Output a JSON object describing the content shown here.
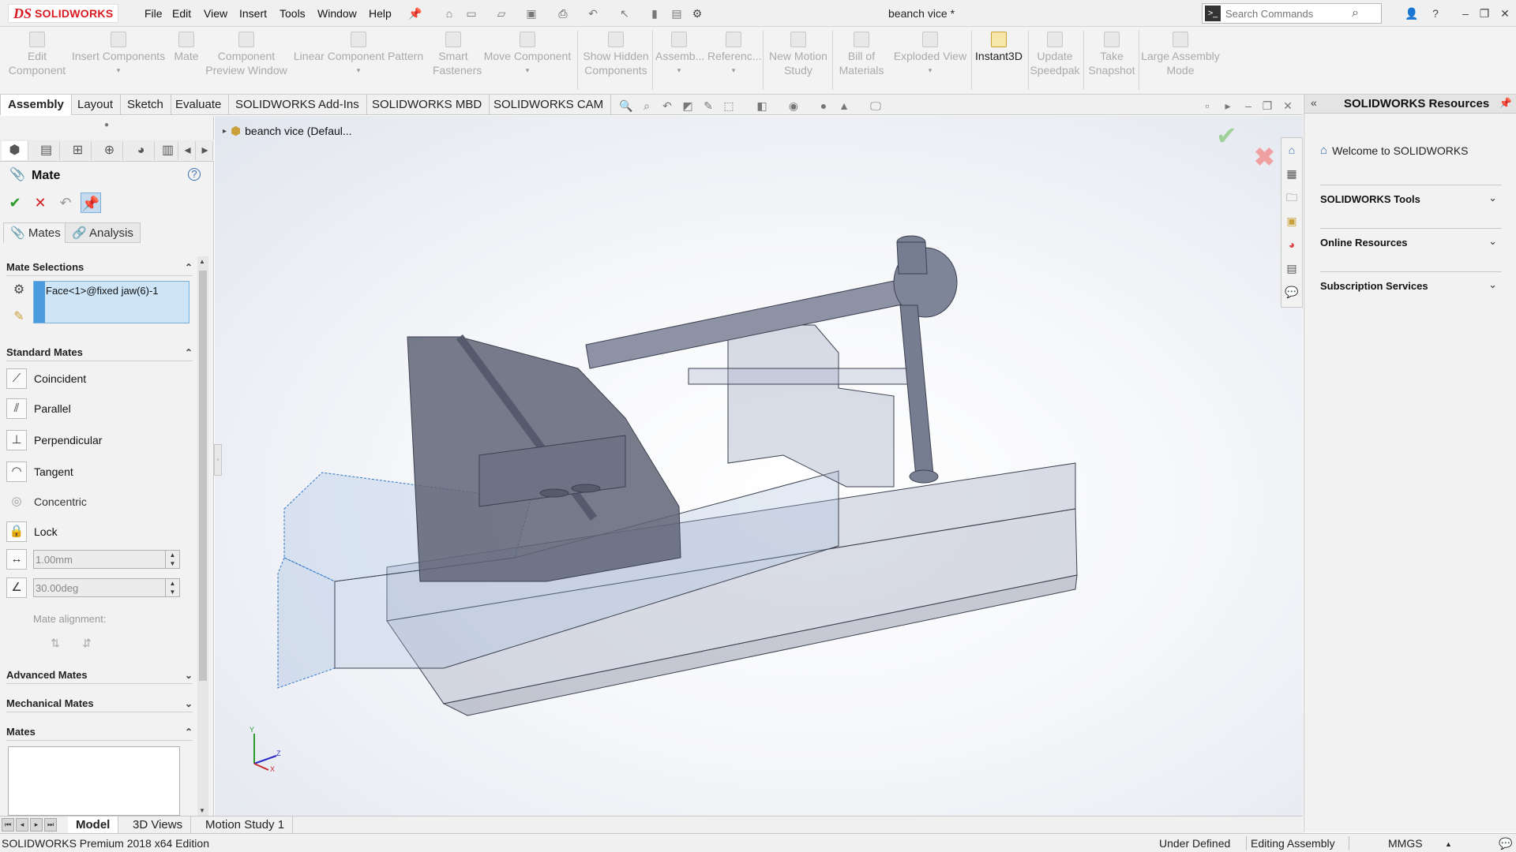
{
  "app": {
    "logo_ds": "DS",
    "logo_text": "SOLIDWORKS",
    "document_title": "beanch vice *"
  },
  "menu": [
    "File",
    "Edit",
    "View",
    "Insert",
    "Tools",
    "Window",
    "Help"
  ],
  "search": {
    "placeholder": "Search Commands"
  },
  "command_manager": [
    {
      "label": "Edit\nComponent",
      "enabled": false
    },
    {
      "label": "Insert Components",
      "enabled": false
    },
    {
      "label": "Mate",
      "enabled": false
    },
    {
      "label": "Component\nPreview Window",
      "enabled": false
    },
    {
      "label": "Linear Component Pattern",
      "enabled": false
    },
    {
      "label": "Smart\nFasteners",
      "enabled": false
    },
    {
      "label": "Move Component",
      "enabled": false
    },
    {
      "label": "Show Hidden\nComponents",
      "enabled": false
    },
    {
      "label": "Assemb...",
      "enabled": false
    },
    {
      "label": "Referenc...",
      "enabled": false
    },
    {
      "label": "New Motion\nStudy",
      "enabled": false
    },
    {
      "label": "Bill of\nMaterials",
      "enabled": false
    },
    {
      "label": "Exploded View",
      "enabled": false
    },
    {
      "label": "Instant3D",
      "enabled": true
    },
    {
      "label": "Update\nSpeedpak",
      "enabled": false
    },
    {
      "label": "Take\nSnapshot",
      "enabled": false
    },
    {
      "label": "Large Assembly\nMode",
      "enabled": false
    }
  ],
  "tabs": [
    "Assembly",
    "Layout",
    "Sketch",
    "Evaluate",
    "SOLIDWORKS Add-Ins",
    "SOLIDWORKS MBD",
    "SOLIDWORKS CAM"
  ],
  "active_tab": "Assembly",
  "property_manager": {
    "title": "Mate",
    "subtabs": [
      "Mates",
      "Analysis"
    ],
    "mate_selections": {
      "heading": "Mate Selections",
      "items": [
        "Face<1>@fixed jaw(6)-1"
      ]
    },
    "standard_mates": {
      "heading": "Standard Mates",
      "items": [
        "Coincident",
        "Parallel",
        "Perpendicular",
        "Tangent",
        "Concentric",
        "Lock"
      ]
    },
    "distance_value": "1.00mm",
    "angle_value": "30.00deg",
    "mate_alignment_label": "Mate alignment:",
    "advanced_mates": "Advanced Mates",
    "mechanical_mates": "Mechanical Mates",
    "mates_heading": "Mates"
  },
  "feature_tree": {
    "root_label": "beanch vice  (Defaul..."
  },
  "triad": {
    "y": "Y",
    "z": "Z",
    "x": "X"
  },
  "task_pane": {
    "title": "SOLIDWORKS Resources",
    "welcome": "Welcome to SOLIDWORKS",
    "sections": [
      "SOLIDWORKS Tools",
      "Online Resources",
      "Subscription Services"
    ]
  },
  "bottom_tabs": [
    "Model",
    "3D Views",
    "Motion Study 1"
  ],
  "active_bottom_tab": "Model",
  "status": {
    "edition": "SOLIDWORKS Premium 2018 x64 Edition",
    "definition": "Under Defined",
    "mode": "Editing Assembly",
    "units": "MMGS",
    "units_caret": "▲"
  },
  "colors": {
    "brand_red": "#d71920",
    "selection_blue": "#cde5f7",
    "accent_blue": "#4a9be0"
  }
}
